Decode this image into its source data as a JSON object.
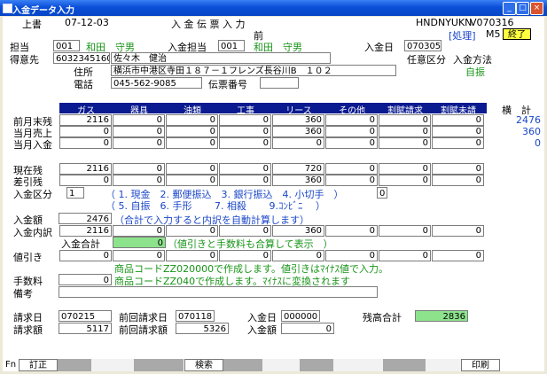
{
  "window": {
    "title": "入金データ入力"
  },
  "header": {
    "mode": "上書",
    "date": "07-12-03",
    "screen_title": "入 金 伝 票 入 力",
    "program_id": "HNDNYUKN",
    "version": "V070316",
    "sub": "前",
    "process_label": "[処理]",
    "mode_code": "M5",
    "exit_label": "終了"
  },
  "form": {
    "tanto_label": "担当",
    "tanto_code": "001",
    "tanto_name": "和田　守男",
    "nyukin_tanto_label": "入金担当",
    "nyukin_tanto_code": "001",
    "nyukin_tanto_name": "和田　守男",
    "nyukin_date_label": "入金日",
    "nyukin_date": "070305",
    "customer_label": "得意先",
    "customer_code": "6032345160",
    "customer_name": "佐々木　健治",
    "optional_label": "任意区分",
    "method_label": "入金方法",
    "method_value": "自振",
    "address_label": "住所",
    "address": "横浜市中港区寺田１８７－１フレンズ長谷川B　１０２",
    "phone_label": "電話",
    "phone": "045-562-9085",
    "slip_label": "伝票番号",
    "slip_no": ""
  },
  "grid": {
    "columns": [
      "ガス",
      "器具",
      "油類",
      "工事",
      "リース",
      "その他",
      "割賦請求",
      "割賦未請",
      "横　計"
    ],
    "rows": [
      {
        "label": "前月末残",
        "values": [
          "2116",
          "0",
          "0",
          "0",
          "360",
          "0",
          "0",
          "0"
        ],
        "total": "2476"
      },
      {
        "label": "当月売上",
        "values": [
          "0",
          "0",
          "0",
          "0",
          "360",
          "0",
          "0",
          "0"
        ],
        "total": "360"
      },
      {
        "label": "当月入金",
        "values": [
          "0",
          "0",
          "0",
          "0",
          "0",
          "0",
          "0",
          "0"
        ],
        "total": "0"
      }
    ],
    "current_label": "現在残",
    "current_values": [
      "2116",
      "0",
      "0",
      "0",
      "720",
      "0",
      "0",
      "0"
    ],
    "diff_label": "差引残",
    "diff_values": [
      "0",
      "0",
      "0",
      "0",
      "360",
      "0",
      "0",
      "0"
    ]
  },
  "kubun": {
    "label": "入金区分",
    "value": "1",
    "value2": "0",
    "line1": "（ 1. 現金　2. 郵便振込　3. 銀行振込　4. 小切手　）",
    "line2": "（ 5. 自振　6. 手形　　 7. 相殺　　 9.ｺﾝﾋﾞﾆ　 ）"
  },
  "amount": {
    "label": "入金額",
    "value": "2476",
    "hint": "（合計で入力すると内訳を自動計算します）",
    "detail_label": "入金内訳",
    "detail_values": [
      "2116",
      "0",
      "0",
      "0",
      "360",
      "0",
      "0",
      "0"
    ],
    "sum_label": "入金合計",
    "sum_value": "0",
    "sum_hint": "（値引きと手数料も合算して表示　）"
  },
  "discount": {
    "label": "値引き",
    "values": [
      "0",
      "0",
      "0",
      "0",
      "0",
      "0",
      "0",
      "0"
    ],
    "note": "商品コードZZ020000で作成します。値引きはﾏｲﾅｽ値で入力。"
  },
  "fee": {
    "label": "手数料",
    "value": "0",
    "note": "商品コードZZ040で作成します。ﾏｲﾅｽに変換されます"
  },
  "remarks": {
    "label": "備考",
    "value": ""
  },
  "billing": {
    "bill_date_label": "請求日",
    "bill_date": "070215",
    "prev_bill_date_label": "前回請求日",
    "prev_bill_date": "070118",
    "pay_date_label": "入金日",
    "pay_date": "000000",
    "balance_label": "残高合計",
    "balance": "2836",
    "bill_amount_label": "請求額",
    "bill_amount": "5117",
    "prev_bill_amount_label": "前回請求額",
    "prev_bill_amount": "5326",
    "pay_amount_label": "入金額",
    "pay_amount": "0"
  },
  "fnbar": {
    "label": "Fn",
    "f1": "訂正",
    "f5": "検索",
    "f12": "印刷"
  }
}
